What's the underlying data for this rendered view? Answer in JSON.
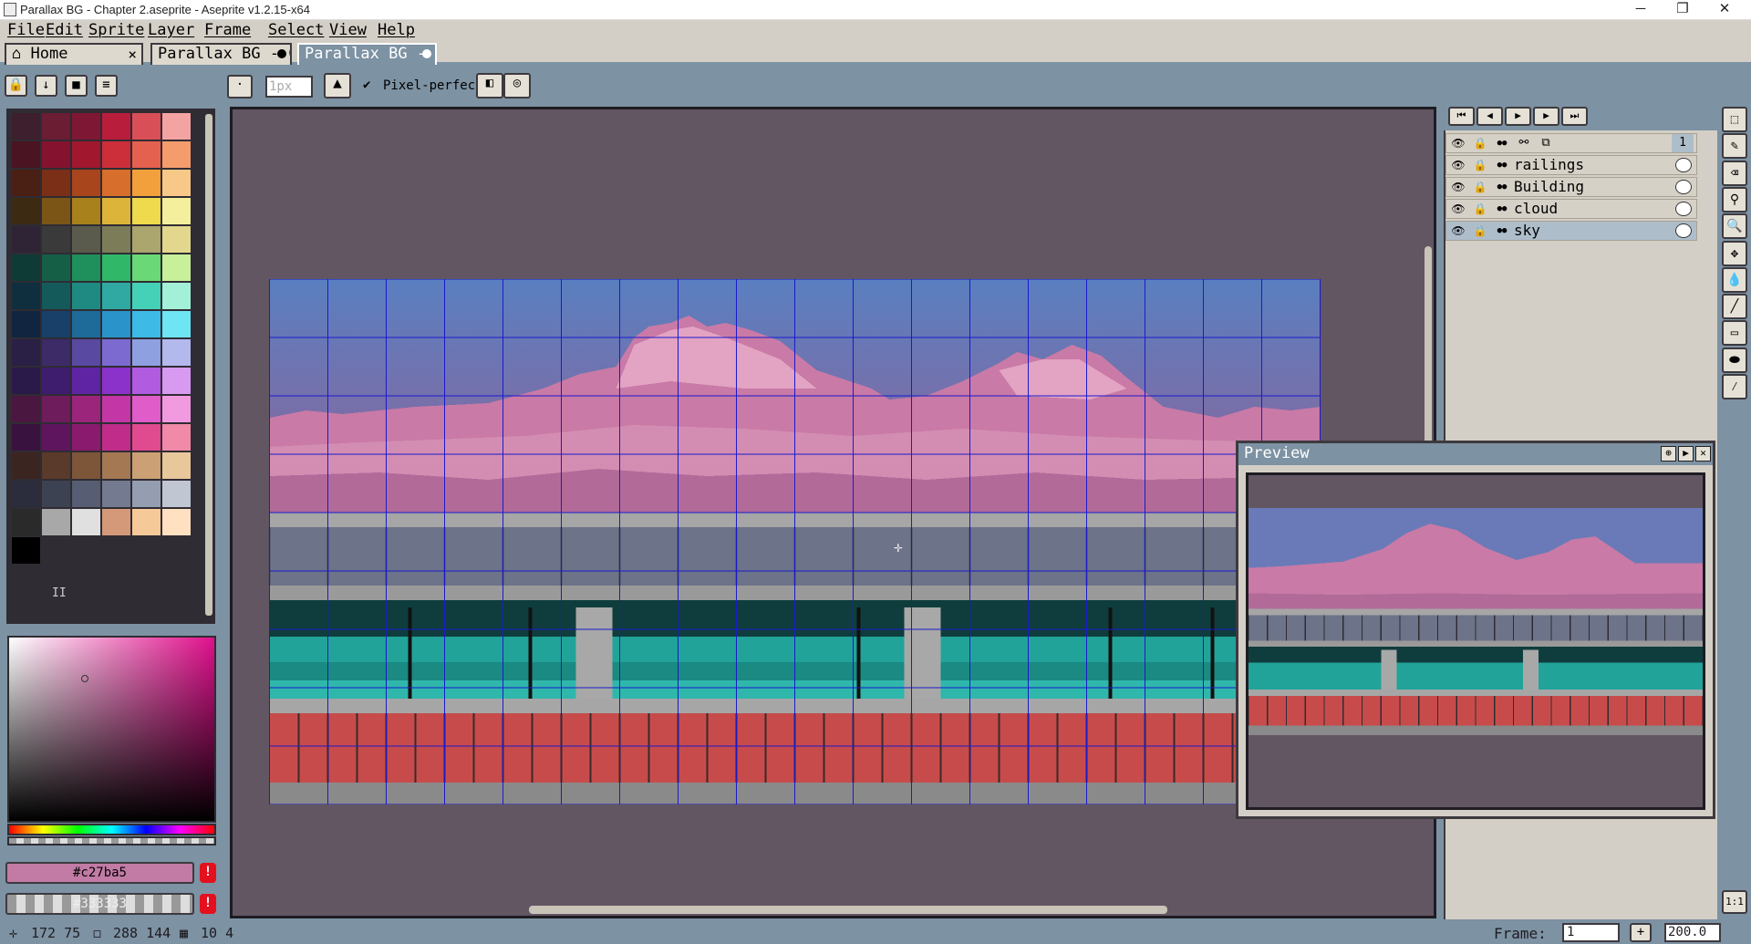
{
  "window": {
    "title": "Parallax BG - Chapter 2.aseprite - Aseprite v1.2.15-x64",
    "minimize": "─",
    "maximize": "❐",
    "close": "✕"
  },
  "menu": [
    "File",
    "Edit",
    "Sprite",
    "Layer",
    "Frame",
    "Select",
    "View",
    "Help"
  ],
  "tabs": [
    {
      "label": "Home",
      "close": "×"
    },
    {
      "label": "Parallax BG - C",
      "close": ""
    },
    {
      "label": "Parallax BG - C",
      "close": ""
    }
  ],
  "toolbar": {
    "brush_size": "1px",
    "pixel_perfect": "Pixel-perfect",
    "check": "✔"
  },
  "palette": {
    "colors": [
      "#3d1f2e",
      "#6a1d33",
      "#7e1733",
      "#b81e3c",
      "#d94f57",
      "#f4a3a3",
      "#4a1422",
      "#85122e",
      "#a0172e",
      "#cc2e3a",
      "#e5614f",
      "#f49c6b",
      "#4a1f14",
      "#7c2f17",
      "#a8451d",
      "#d86e2b",
      "#f2a03b",
      "#f8c889",
      "#3d2a12",
      "#7a5515",
      "#a8801c",
      "#dcb43a",
      "#efd94c",
      "#f4ef9c",
      "#2e2435",
      "#3b3a3b",
      "#5b5b4d",
      "#7c7d58",
      "#aba56e",
      "#e2d78d",
      "#0f3b36",
      "#155f47",
      "#1f8f5b",
      "#30b868",
      "#6ad877",
      "#c8f09a",
      "#0f2f3e",
      "#155a5a",
      "#1f8a82",
      "#2fa9a1",
      "#45d1b8",
      "#a3f0d8",
      "#122540",
      "#184068",
      "#1e6a99",
      "#2a93c9",
      "#3dbbe6",
      "#6de5f2",
      "#2a1f44",
      "#3c2b66",
      "#5a49a0",
      "#7c6ad0",
      "#8fa0e0",
      "#b3b8ed",
      "#2a1a4a",
      "#3e1c6e",
      "#5e24a3",
      "#8a32c9",
      "#b05be0",
      "#d79af0",
      "#4a1740",
      "#6e1c5c",
      "#9b257a",
      "#c336a5",
      "#e05cc8",
      "#f29ae0",
      "#3a1240",
      "#5e155e",
      "#8a1a6e",
      "#c02c8a",
      "#e04a8f",
      "#f08aa8",
      "#3b2520",
      "#5a3a2a",
      "#7d5538",
      "#a47852",
      "#caa074",
      "#e8c79b",
      "#2b2d3c",
      "#3d4253",
      "#575d72",
      "#747b90",
      "#959db0",
      "#c0c6d2",
      "#2a2a2a",
      "#a8a8a8",
      "#e0e0e0",
      "#d49979",
      "#f6c999",
      "#ffe0c0",
      "#000000"
    ],
    "extra_label": "II"
  },
  "colors": {
    "fg_hex": "#c27ba5",
    "bg_hex": "#333333",
    "warn_icon": "!"
  },
  "layers": [
    {
      "name": "",
      "header": true,
      "frame_no": "1"
    },
    {
      "name": "railings"
    },
    {
      "name": "Building"
    },
    {
      "name": "cloud"
    },
    {
      "name": "sky",
      "selected": true
    }
  ],
  "anim_buttons": [
    "⏮",
    "◀",
    "▶",
    "▶",
    "⏭"
  ],
  "preview": {
    "title": "Preview"
  },
  "status": {
    "pos": "172 75",
    "size": "288 144",
    "grid": "10 4",
    "frame_label": "Frame:",
    "frame_value": "1",
    "zoom": "200.0",
    "add": "+",
    "one_to_one": "1:1"
  }
}
